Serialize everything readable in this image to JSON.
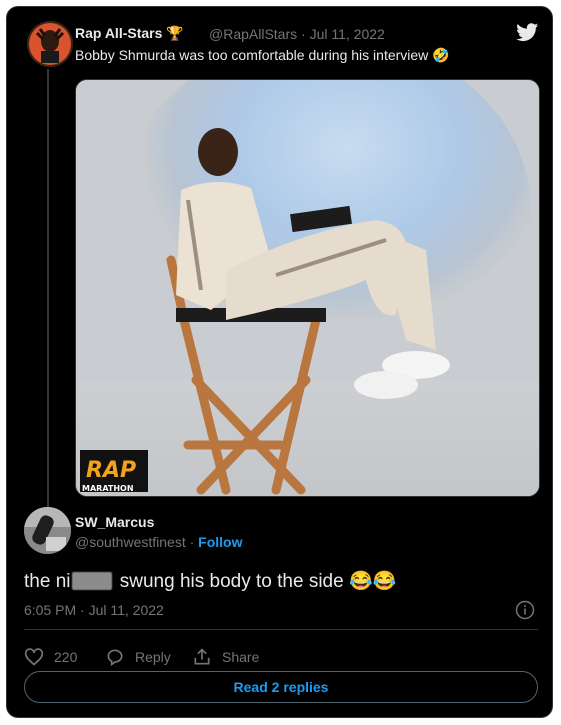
{
  "tweet": {
    "author_name": "Rap All-Stars",
    "author_badge": "🏆",
    "author_handle_date": "@RapAllStars · Jul 11, 2022",
    "text": "Bobby Shmurda was too comfortable during his interview",
    "text_emoji": "🤣",
    "media_watermark_top": "RAP",
    "media_watermark_bottom": "MARATHON"
  },
  "reply": {
    "author_name": "SW_Marcus",
    "author_handle": "@southwestfinest",
    "separator": " · ",
    "follow_label": "Follow",
    "text_before": "the ni",
    "text_after": " swung his body to the side ",
    "text_emoji": "😂😂",
    "timestamp": "6:05 PM · Jul 11, 2022",
    "like_count": "220",
    "reply_label": "Reply",
    "share_label": "Share",
    "read_replies_label": "Read 2 replies"
  },
  "colors": {
    "background": "#000000",
    "text": "#e7e9ea",
    "secondary": "#71767b",
    "accent": "#1d9bf0",
    "border": "#2f3336"
  }
}
